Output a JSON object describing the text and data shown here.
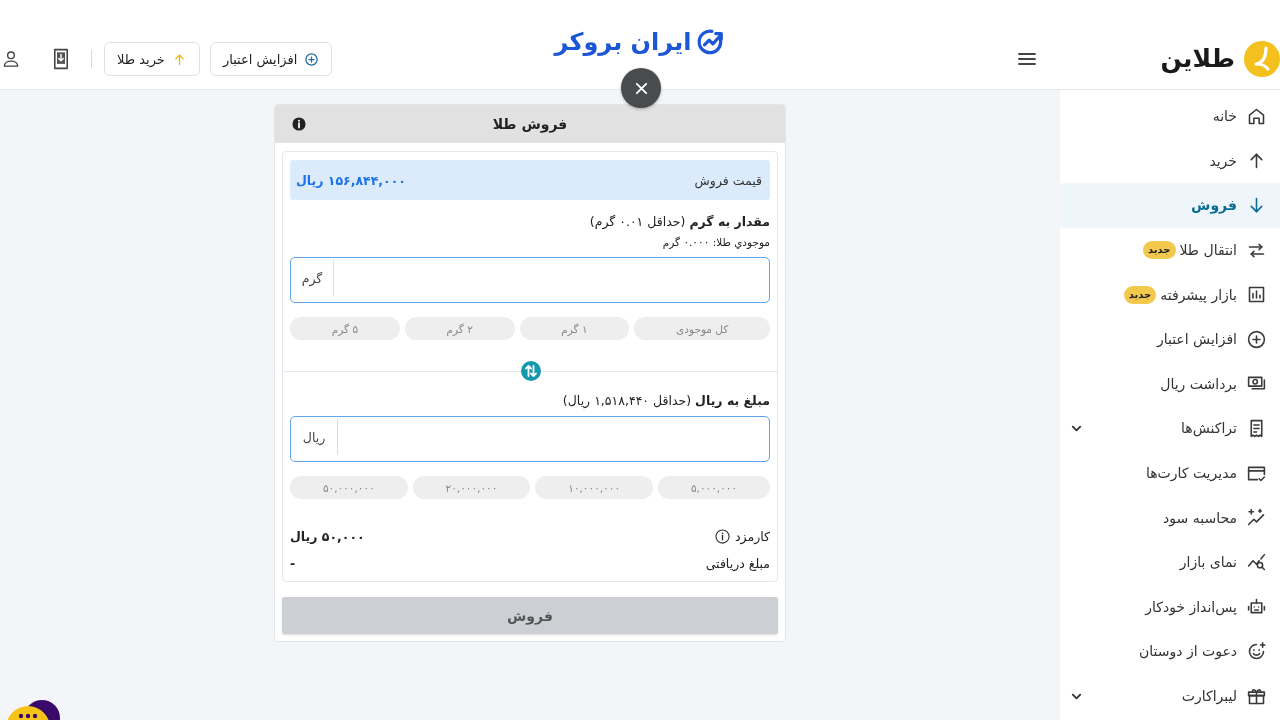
{
  "header": {
    "brand": "طلاین",
    "partner_logo": "ایران بروکر",
    "buttons": [
      "افزایش اعتبار",
      "خرید طلا"
    ]
  },
  "sidebar": {
    "items": [
      {
        "label": "خانه",
        "selected": false,
        "submenu": false
      },
      {
        "label": "خرید",
        "selected": false,
        "submenu": false
      },
      {
        "label": "فروش",
        "selected": true,
        "submenu": false
      },
      {
        "label": "انتقال طلا",
        "selected": false,
        "submenu": false,
        "badge": "جدید"
      },
      {
        "label": "بازار پیشرفته",
        "selected": false,
        "submenu": false,
        "badge": "جدید"
      },
      {
        "label": "افزایش اعتبار",
        "selected": false,
        "submenu": false
      },
      {
        "label": "برداشت ریال",
        "selected": false,
        "submenu": false
      },
      {
        "label": "تراکنش‌ها",
        "selected": false,
        "submenu": true
      },
      {
        "label": "مدیریت کارت‌ها",
        "selected": false,
        "submenu": false
      },
      {
        "label": "محاسبه سود",
        "selected": false,
        "submenu": false
      },
      {
        "label": "نمای بازار",
        "selected": false,
        "submenu": false
      },
      {
        "label": "پس‌انداز خودکار",
        "selected": false,
        "submenu": false
      },
      {
        "label": "دعوت از دوستان",
        "selected": false,
        "submenu": false
      },
      {
        "label": "لیبراکارت",
        "selected": false,
        "submenu": true
      }
    ]
  },
  "dialog": {
    "title": "فروش طلا",
    "price": {
      "label": "قیمت فروش",
      "value": "۱۵۶,۸۴۴,۰۰۰ ریال"
    },
    "gram": {
      "label": "**مقدار به گرم** (حداقل ۰.۰۱ گرم)",
      "balance": "موجودي طلا: ۰.۰۰۰ گرم",
      "unit": "گرم",
      "presets": [
        "کل موجودی",
        "۱ گرم",
        "۲ گرم",
        "۵ گرم"
      ]
    },
    "rial": {
      "label": "**مبلغ به ریال** (حداقل ۱,۵۱۸,۴۴۰ ریال)",
      "unit": "ریال",
      "presets": [
        "۵,۰۰۰,۰۰۰",
        "۱۰,۰۰۰,۰۰۰",
        "۲۰,۰۰۰,۰۰۰",
        "۵۰,۰۰۰,۰۰۰"
      ]
    },
    "summary": [
      {
        "label": "کارمزد",
        "value": "۵۰,۰۰۰ ریال",
        "info": true
      },
      {
        "label": "مبلغ دریافتی",
        "value": "-",
        "info": false
      }
    ],
    "submit": {
      "label": "فروش",
      "disabled": true
    }
  }
}
